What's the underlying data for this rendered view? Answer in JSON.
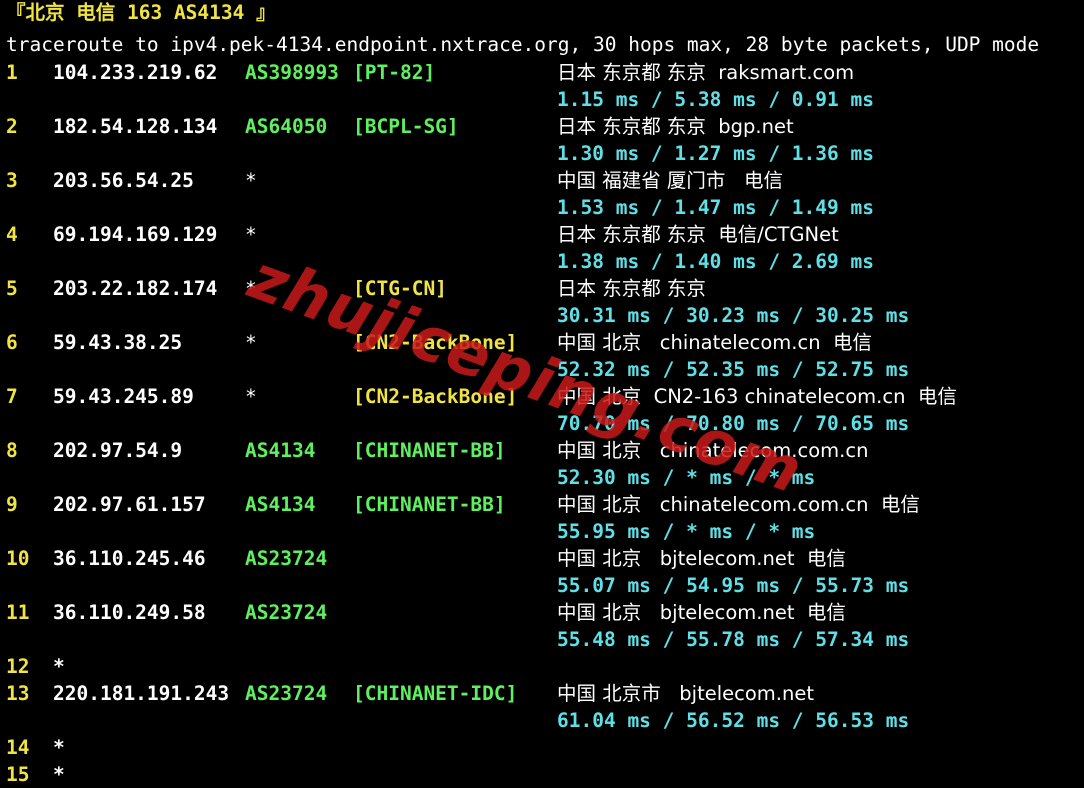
{
  "header": {
    "title": "『北京 电信 163 AS4134 』",
    "command": "traceroute to ipv4.pek-4134.endpoint.nxtrace.org, 30 hops max, 28 byte packets, UDP mode"
  },
  "hops": [
    {
      "num": "1",
      "ip": "104.233.219.62",
      "asn": "AS398993",
      "tag": "[PT-82]",
      "tag_color": "green",
      "geo": "日本 东京都 东京  raksmart.com",
      "rtt": "1.15 ms / 5.38 ms / 0.91 ms"
    },
    {
      "num": "2",
      "ip": "182.54.128.134",
      "asn": "AS64050",
      "tag": "[BCPL-SG]",
      "tag_color": "green",
      "geo": "日本 东京都 东京  bgp.net",
      "rtt": "1.30 ms / 1.27 ms / 1.36 ms"
    },
    {
      "num": "3",
      "ip": "203.56.54.25",
      "asn": "*",
      "tag": "",
      "tag_color": "",
      "geo": "中国 福建省 厦门市   电信",
      "rtt": "1.53 ms / 1.47 ms / 1.49 ms"
    },
    {
      "num": "4",
      "ip": "69.194.169.129",
      "asn": "*",
      "tag": "",
      "tag_color": "",
      "geo": "日本 东京都 东京  电信/CTGNet",
      "rtt": "1.38 ms / 1.40 ms / 2.69 ms"
    },
    {
      "num": "5",
      "ip": "203.22.182.174",
      "asn": "*",
      "tag": "[CTG-CN]",
      "tag_color": "yellow",
      "geo": "日本 东京都 东京",
      "rtt": "30.31 ms / 30.23 ms / 30.25 ms"
    },
    {
      "num": "6",
      "ip": "59.43.38.25",
      "asn": "*",
      "tag": "[CN2-BackBone]",
      "tag_color": "yellow",
      "geo": "中国 北京   chinatelecom.cn  电信",
      "rtt": "52.32 ms / 52.35 ms / 52.75 ms"
    },
    {
      "num": "7",
      "ip": "59.43.245.89",
      "asn": "*",
      "tag": "[CN2-BackBone]",
      "tag_color": "yellow",
      "geo": "中国 北京  CN2-163 chinatelecom.cn  电信",
      "rtt": "70.70 ms / 70.80 ms / 70.65 ms"
    },
    {
      "num": "8",
      "ip": "202.97.54.9",
      "asn": "AS4134",
      "tag": "[CHINANET-BB]",
      "tag_color": "green",
      "geo": "中国 北京   chinatelecom.com.cn",
      "rtt": "52.30 ms / * ms / * ms"
    },
    {
      "num": "9",
      "ip": "202.97.61.157",
      "asn": "AS4134",
      "tag": "[CHINANET-BB]",
      "tag_color": "green",
      "geo": "中国 北京   chinatelecom.com.cn  电信",
      "rtt": "55.95 ms / * ms / * ms"
    },
    {
      "num": "10",
      "ip": "36.110.245.46",
      "asn": "AS23724",
      "tag": "",
      "tag_color": "",
      "geo": "中国 北京   bjtelecom.net  电信",
      "rtt": "55.07 ms / 54.95 ms / 55.73 ms"
    },
    {
      "num": "11",
      "ip": "36.110.249.58",
      "asn": "AS23724",
      "tag": "",
      "tag_color": "",
      "geo": "中国 北京   bjtelecom.net  电信",
      "rtt": "55.48 ms / 55.78 ms / 57.34 ms"
    },
    {
      "num": "12",
      "ip": "*",
      "asn": "",
      "tag": "",
      "tag_color": "",
      "geo": "",
      "rtt": ""
    },
    {
      "num": "13",
      "ip": "220.181.191.243",
      "asn": "AS23724",
      "tag": "[CHINANET-IDC]",
      "tag_color": "green",
      "geo": "中国 北京市   bjtelecom.net",
      "rtt": "61.04 ms / 56.52 ms / 56.53 ms"
    },
    {
      "num": "14",
      "ip": "*",
      "asn": "",
      "tag": "",
      "tag_color": "",
      "geo": "",
      "rtt": ""
    },
    {
      "num": "15",
      "ip": "*",
      "asn": "",
      "tag": "",
      "tag_color": "",
      "geo": "",
      "rtt": ""
    }
  ],
  "watermark": "zhujiceping.com",
  "colors": {
    "background": "#000000",
    "hop_number": "#f0e442",
    "asn": "#5ef05e",
    "tag_yellow": "#f0e442",
    "rtt": "#5ee0e6",
    "watermark": "#c81919"
  }
}
